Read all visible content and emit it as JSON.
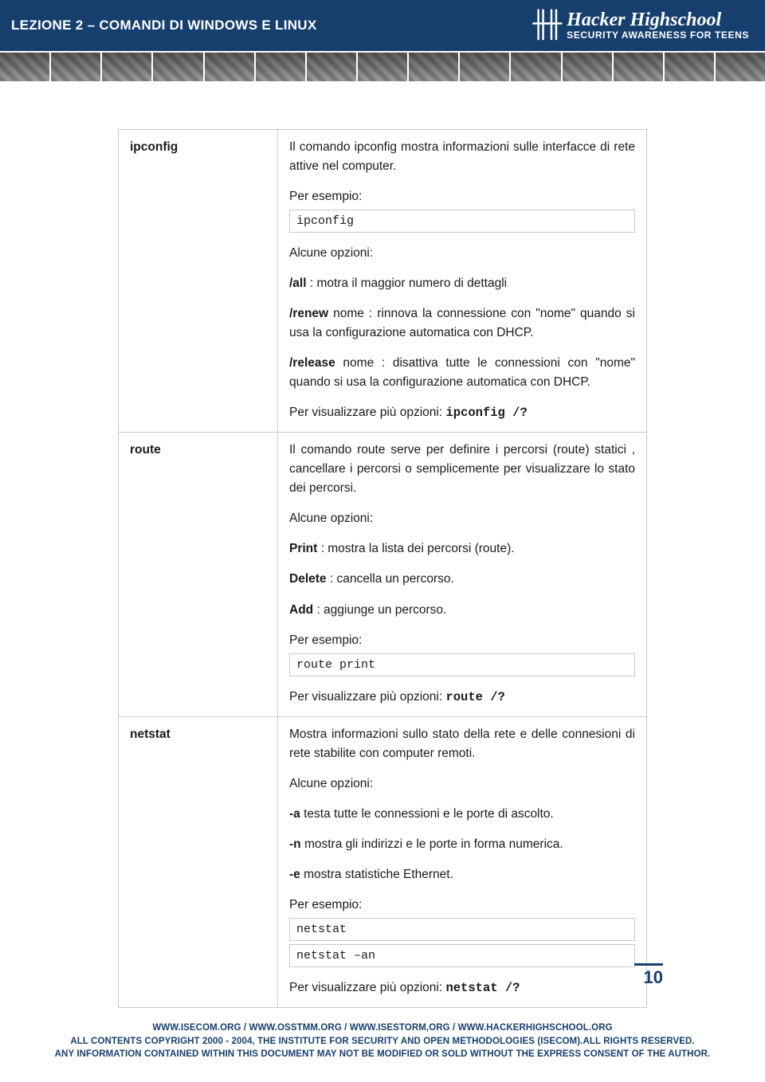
{
  "header": {
    "lesson": "LEZIONE 2 – COMANDI DI WINDOWS E LINUX",
    "logo_mark": "╫╫",
    "brand_top": "Hacker Highschool",
    "brand_sub": "SECURITY AWARENESS FOR TEENS"
  },
  "table": {
    "rows": [
      {
        "name": "ipconfig",
        "intro": "Il comando ipconfig mostra informazioni sulle interfacce di rete attive nel computer.",
        "esempio_label": "Per esempio:",
        "esempio_code": "ipconfig",
        "opts_label": "Alcune opzioni:",
        "opt1_b": "/all",
        "opt1_t": " : motra il maggior numero di dettagli",
        "opt2_b": "/renew",
        "opt2_t": " nome : rinnova la connessione con \"nome\" quando si usa la configurazione automatica con DHCP.",
        "opt3_b": "/release",
        "opt3_t": " nome : disattiva tutte le connessioni con \"nome\" quando si usa la configurazione automatica con DHCP.",
        "more_pre": "Per visualizzare più opzioni: ",
        "more_cmd": "ipconfig /?"
      },
      {
        "name": "route",
        "intro": "Il comando route serve per definire i percorsi (route) statici , cancellare i percorsi o semplicemente per visualizzare lo stato dei percorsi.",
        "opts_label": "Alcune opzioni:",
        "opt1_b": "Print",
        "opt1_t": "  : mostra la lista dei percorsi (route).",
        "opt2_b": "Delete",
        "opt2_t": "  : cancella un percorso.",
        "opt3_b": "Add",
        "opt3_t": "  : aggiunge un percorso.",
        "esempio_label": "Per esempio:",
        "esempio_code": "route print",
        "more_pre": "Per visualizzare più opzioni:  ",
        "more_cmd": "route /?"
      },
      {
        "name": "netstat",
        "intro": "Mostra informazioni sullo stato della rete e delle connesioni di rete stabilite con computer remoti.",
        "opts_label": "Alcune opzioni:",
        "opt1_b": "-a",
        "opt1_t": " testa tutte le connessioni e le porte di ascolto.",
        "opt2_b": "-n",
        "opt2_t": " mostra gli indirizzi e le porte in forma numerica.",
        "opt3_b": "-e",
        "opt3_t": " mostra statistiche Ethernet.",
        "esempio_label": "Per esempio:",
        "esempio_code1": "netstat",
        "esempio_code2": "netstat –an",
        "more_pre": "Per visualizzare più opzioni:  ",
        "more_cmd": "netstat /?"
      }
    ]
  },
  "page_number": "10",
  "footer": {
    "l1": "WWW.ISECOM.ORG / WWW.OSSTMM.ORG / WWW.ISESTORM,ORG / WWW.HACKERHIGHSCHOOL.ORG",
    "l2": "ALL CONTENTS COPYRIGHT 2000 - 2004, THE INSTITUTE FOR SECURITY AND OPEN METHODOLOGIES (ISECOM).ALL RIGHTS RESERVED.",
    "l3": "ANY INFORMATION CONTAINED WITHIN THIS DOCUMENT MAY NOT BE MODIFIED OR SOLD WITHOUT THE EXPRESS CONSENT OF THE AUTHOR."
  }
}
